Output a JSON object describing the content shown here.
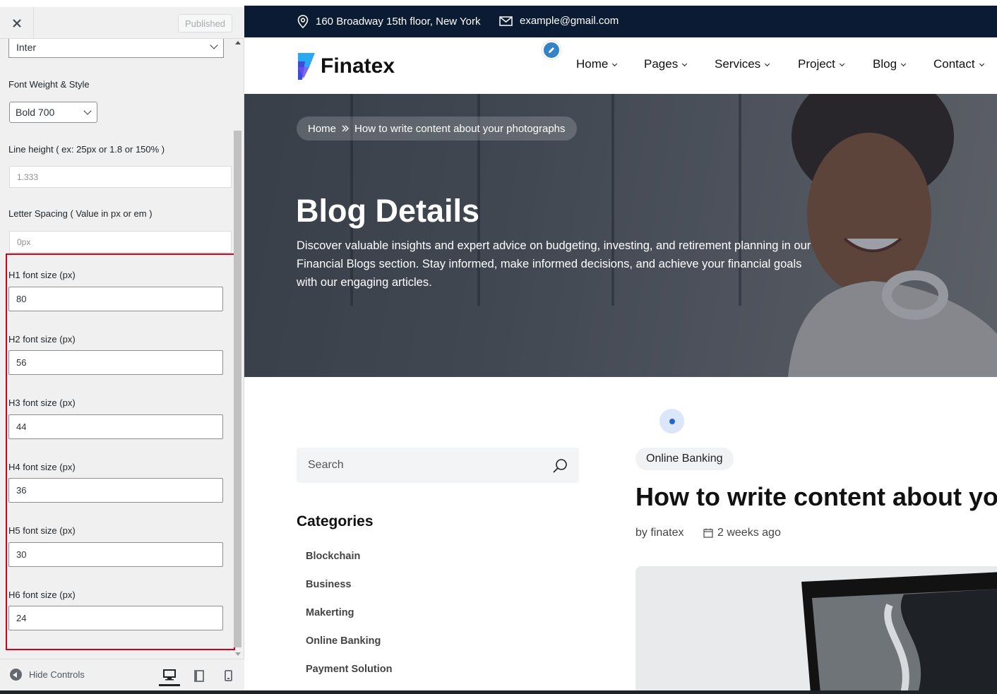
{
  "customizer": {
    "published_label": "Published",
    "font_family_value": "Inter",
    "font_weight_label": "Font Weight & Style",
    "font_weight_value": "Bold 700",
    "line_height_label": "Line height ( ex: 25px or 1.8 or 150% )",
    "line_height_placeholder": "1.333",
    "letter_spacing_label": "Letter Spacing ( Value in px or em )",
    "letter_spacing_placeholder": "0px",
    "headings": [
      {
        "label": "H1 font size (px)",
        "value": "80"
      },
      {
        "label": "H2 font size (px)",
        "value": "56"
      },
      {
        "label": "H3 font size (px)",
        "value": "44"
      },
      {
        "label": "H4 font size (px)",
        "value": "36"
      },
      {
        "label": "H5 font size (px)",
        "value": "30"
      },
      {
        "label": "H6 font size (px)",
        "value": "24"
      }
    ],
    "hide_controls_label": "Hide Controls",
    "highlight_color": "#d0021b"
  },
  "site": {
    "topbar": {
      "address": "160 Broadway 15th floor, New York",
      "email": "example@gmail.com",
      "background": "#0b1b33"
    },
    "logo_text": "Finatex",
    "nav": [
      "Home",
      "Pages",
      "Services",
      "Project",
      "Blog",
      "Contact"
    ],
    "hero": {
      "breadcrumb_home": "Home",
      "breadcrumb_current": "How to write content about your photographs",
      "title": "Blog Details",
      "description": "Discover valuable insights and expert advice on budgeting, investing, and retirement planning in our Financial Blogs section. Stay informed, make informed decisions, and achieve your financial goals with our engaging articles."
    },
    "sidebar": {
      "search_placeholder": "Search",
      "categories_title": "Categories",
      "categories": [
        "Blockchain",
        "Business",
        "Makerting",
        "Online Banking",
        "Payment Solution"
      ]
    },
    "post": {
      "tag": "Online Banking",
      "title": "How to write content about your photographs",
      "author": "by finatex",
      "date": "2 weeks ago"
    }
  }
}
